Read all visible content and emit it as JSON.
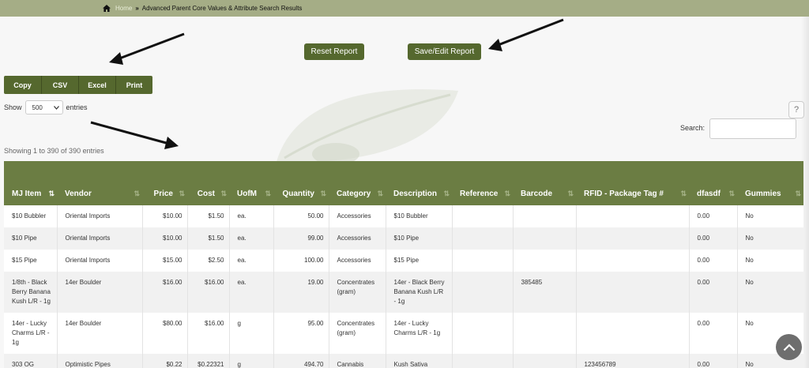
{
  "breadcrumb": {
    "home": "Home",
    "separator": "»",
    "current": "Advanced Parent Core Values & Attribute Search Results"
  },
  "actions": {
    "reset": "Reset Report",
    "save": "Save/Edit Report"
  },
  "export": [
    "Copy",
    "CSV",
    "Excel",
    "Print"
  ],
  "length": {
    "prefix": "Show",
    "value": "500",
    "suffix": "entries"
  },
  "help": "?",
  "search": {
    "label": "Search:",
    "value": ""
  },
  "info": "Showing 1 to 390 of 390 entries",
  "colors": {
    "header_bar": "#a5ad86",
    "button": "#55682e",
    "table_header": "#6b7d43"
  },
  "table": {
    "columns": [
      "MJ Item",
      "Vendor",
      "Price",
      "Cost",
      "UofM",
      "Quantity",
      "Category",
      "Description",
      "Reference",
      "Barcode",
      "RFID - Package Tag #",
      "dfasdf",
      "Gummies"
    ],
    "rows": [
      [
        "$10 Bubbler",
        "Oriental Imports",
        "$10.00",
        "$1.50",
        "ea.",
        "50.00",
        "Accessories",
        "$10 Bubbler",
        "",
        "",
        "",
        "0.00",
        "No"
      ],
      [
        "$10 Pipe",
        "Oriental Imports",
        "$10.00",
        "$1.50",
        "ea.",
        "99.00",
        "Accessories",
        "$10 Pipe",
        "",
        "",
        "",
        "0.00",
        "No"
      ],
      [
        "$15 Pipe",
        "Oriental Imports",
        "$15.00",
        "$2.50",
        "ea.",
        "100.00",
        "Accessories",
        "$15 Pipe",
        "",
        "",
        "",
        "0.00",
        "No"
      ],
      [
        "1/8th - Black Berry Banana Kush L/R - 1g",
        "14er Boulder",
        "$16.00",
        "$16.00",
        "ea.",
        "19.00",
        "Concentrates (gram)",
        "14er - Black Berry Banana Kush L/R - 1g",
        "",
        "385485",
        "",
        "0.00",
        "No"
      ],
      [
        "14er - Lucky Charms L/R - 1g",
        "14er Boulder",
        "$80.00",
        "$16.00",
        "g",
        "95.00",
        "Concentrates (gram)",
        "14er - Lucky Charms L/R - 1g",
        "",
        "",
        "",
        "0.00",
        "No"
      ],
      [
        "303 OG",
        "Optimistic Pipes",
        "$0.22",
        "$0.22321",
        "g",
        "494.70",
        "Cannabis",
        "Kush Sativa",
        "",
        "",
        "123456789",
        "0.00",
        "No"
      ]
    ]
  }
}
